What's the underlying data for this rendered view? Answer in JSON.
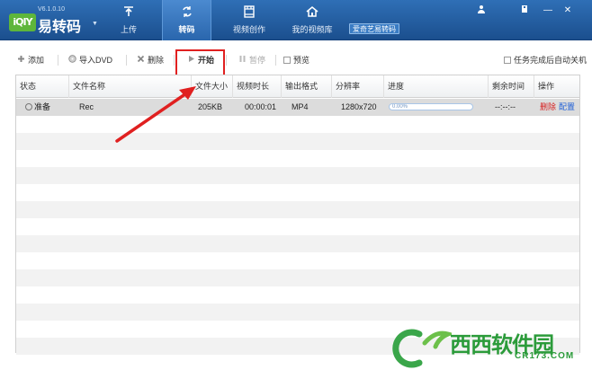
{
  "app": {
    "logo_text": "iQIY",
    "version": "V6.1.0.10",
    "name": "易转码"
  },
  "nav": {
    "tabs": [
      {
        "label": "上传",
        "icon": "upload-icon"
      },
      {
        "label": "转码",
        "icon": "transcode-icon",
        "active": true
      },
      {
        "label": "视频创作",
        "icon": "film-icon"
      },
      {
        "label": "我的视频库",
        "icon": "home-icon"
      }
    ],
    "badge": "爱奇艺易转码"
  },
  "window": {
    "user_icon": "user-icon",
    "menu_icon": "menu-icon",
    "minimize": "—",
    "close": "✕"
  },
  "toolbar": {
    "add": "添加",
    "import_dvd": "导入DVD",
    "delete": "删除",
    "start": "开始",
    "pause": "暂停",
    "preview": "预览",
    "auto_shutdown": "任务完成后自动关机"
  },
  "table": {
    "columns": [
      "状态",
      "文件名称",
      "文件大小",
      "视频时长",
      "输出格式",
      "分辨率",
      "进度",
      "剩余时间",
      "操作"
    ],
    "rows": [
      {
        "status": "准备",
        "name": "Rec",
        "size": "205KB",
        "duration": "00:00:01",
        "format": "MP4",
        "resolution": "1280x720",
        "progress_text": "0.00%",
        "progress": 0.0,
        "remaining": "--:--:--",
        "action_delete": "删除",
        "action_config": "配置"
      }
    ],
    "empty_rows": 14
  },
  "watermark": {
    "name": "西西软件园",
    "url": "CR173.COM"
  },
  "colors": {
    "topbar": "#1b4f8e",
    "highlight": "#e02020",
    "delete_link": "#d61f1f",
    "config_link": "#1f5fd6",
    "watermark": "#2b9b3a"
  }
}
